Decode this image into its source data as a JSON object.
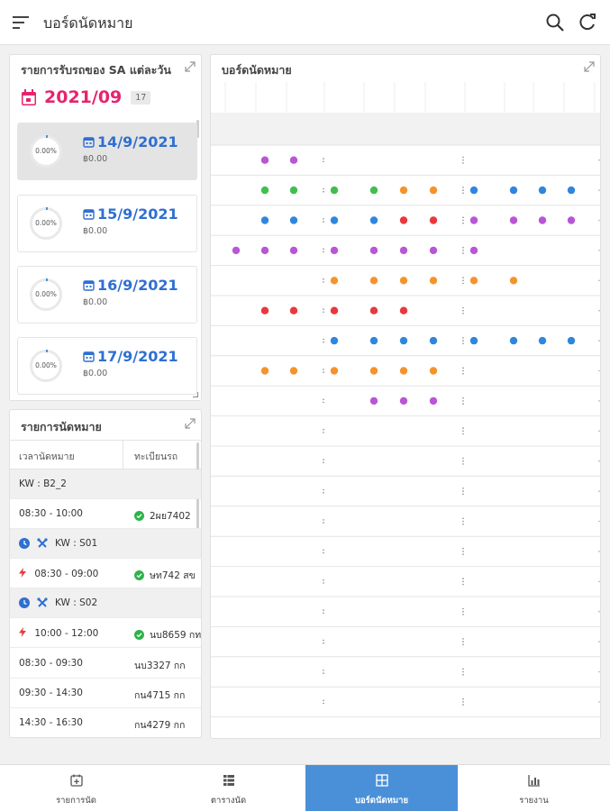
{
  "app": {
    "title": "บอร์ดนัดหมาย"
  },
  "daily_panel": {
    "title": "รายการรับรถของ SA แต่ละวัน",
    "month": "2021/09",
    "count": "17",
    "days": [
      {
        "date": "14/9/2021",
        "amount": "฿0.00",
        "percent": "0.00%",
        "selected": true
      },
      {
        "date": "15/9/2021",
        "amount": "฿0.00",
        "percent": "0.00%",
        "selected": false
      },
      {
        "date": "16/9/2021",
        "amount": "฿0.00",
        "percent": "0.00%",
        "selected": false
      },
      {
        "date": "17/9/2021",
        "amount": "฿0.00",
        "percent": "0.00%",
        "selected": false
      }
    ]
  },
  "appointments_panel": {
    "title": "รายการนัดหมาย",
    "columns": [
      "เวลานัดหมาย",
      "ทะเบียนรถ"
    ],
    "rows": [
      {
        "type": "group",
        "label": "KW : B2_2"
      },
      {
        "type": "item",
        "time": "08:30 - 10:00",
        "plate": "2ผย7402",
        "ok": true,
        "bolt": false
      },
      {
        "type": "group-tech",
        "label": "KW : S01"
      },
      {
        "type": "item",
        "time": "08:30 - 09:00",
        "plate": "ษท742 สข",
        "ok": true,
        "bolt": true
      },
      {
        "type": "group-tech",
        "label": "KW : S02"
      },
      {
        "type": "item",
        "time": "10:00 - 12:00",
        "plate": "นบ8659 กท",
        "ok": true,
        "bolt": true
      },
      {
        "type": "item",
        "time": "08:30 - 09:30",
        "plate": "นบ3327 กก",
        "ok": false,
        "bolt": false
      },
      {
        "type": "item",
        "time": "09:30 - 14:30",
        "plate": "กน4715 กก",
        "ok": false,
        "bolt": false
      },
      {
        "type": "item",
        "time": "14:30 - 16:30",
        "plate": "กน4279 กก",
        "ok": false,
        "bolt": false
      }
    ]
  },
  "board_panel": {
    "title": "บอร์ดนัดหมาย",
    "slot_centers": [
      28,
      60,
      92,
      137,
      181,
      214,
      247,
      292,
      336,
      368,
      400
    ],
    "rows": [
      [
        "",
        "purple",
        "purple",
        "",
        "",
        "",
        "",
        "",
        "",
        "",
        ""
      ],
      [
        "",
        "green",
        "green",
        "green",
        "green",
        "orange",
        "orange",
        "blue",
        "blue",
        "blue",
        "blue"
      ],
      [
        "",
        "blue",
        "blue",
        "blue",
        "blue",
        "red",
        "red",
        "purple",
        "purple",
        "purple",
        "purple"
      ],
      [
        "purple",
        "purple",
        "purple",
        "purple",
        "purple",
        "purple",
        "purple",
        "purple",
        "",
        "",
        ""
      ],
      [
        "",
        "",
        "",
        "orange",
        "orange",
        "orange",
        "orange",
        "orange",
        "orange",
        "",
        ""
      ],
      [
        "",
        "red",
        "red",
        "red",
        "red",
        "red",
        "",
        "",
        "",
        "",
        ""
      ],
      [
        "",
        "",
        "",
        "blue",
        "blue",
        "blue",
        "blue",
        "blue",
        "blue",
        "blue",
        "blue"
      ],
      [
        "",
        "orange",
        "orange",
        "orange",
        "orange",
        "orange",
        "orange",
        "",
        "",
        "",
        ""
      ],
      [
        "",
        "",
        "",
        "",
        "purple",
        "purple",
        "purple",
        "",
        "",
        "",
        ""
      ],
      [
        "",
        "",
        "",
        "",
        "",
        "",
        "",
        "",
        "",
        "",
        ""
      ],
      [
        "",
        "",
        "",
        "",
        "",
        "",
        "",
        "",
        "",
        "",
        ""
      ],
      [
        "",
        "",
        "",
        "",
        "",
        "",
        "",
        "",
        "",
        "",
        ""
      ],
      [
        "",
        "",
        "",
        "",
        "",
        "",
        "",
        "",
        "",
        "",
        ""
      ],
      [
        "",
        "",
        "",
        "",
        "",
        "",
        "",
        "",
        "",
        "",
        ""
      ],
      [
        "",
        "",
        "",
        "",
        "",
        "",
        "",
        "",
        "",
        "",
        ""
      ],
      [
        "",
        "",
        "",
        "",
        "",
        "",
        "",
        "",
        "",
        "",
        ""
      ],
      [
        "",
        "",
        "",
        "",
        "",
        "",
        "",
        "",
        "",
        "",
        ""
      ],
      [
        "",
        "",
        "",
        "",
        "",
        "",
        "",
        "",
        "",
        "",
        ""
      ],
      [
        "",
        "",
        "",
        "",
        "",
        "",
        "",
        "",
        "",
        "",
        ""
      ]
    ]
  },
  "colors": {
    "purple": "#b955d6",
    "green": "#3fbf4f",
    "orange": "#f5932b",
    "blue": "#2f86de",
    "red": "#e8383d",
    "accent": "#4a90d9",
    "month": "#e6246e",
    "date": "#2f6fd1"
  },
  "nav": [
    {
      "label": "รายการนัด",
      "icon": "calendar-add-icon",
      "active": false
    },
    {
      "label": "ตารางนัด",
      "icon": "table-icon",
      "active": false
    },
    {
      "label": "บอร์ดนัดหมาย",
      "icon": "grid-icon",
      "active": true
    },
    {
      "label": "รายงาน",
      "icon": "chart-icon",
      "active": false
    }
  ]
}
